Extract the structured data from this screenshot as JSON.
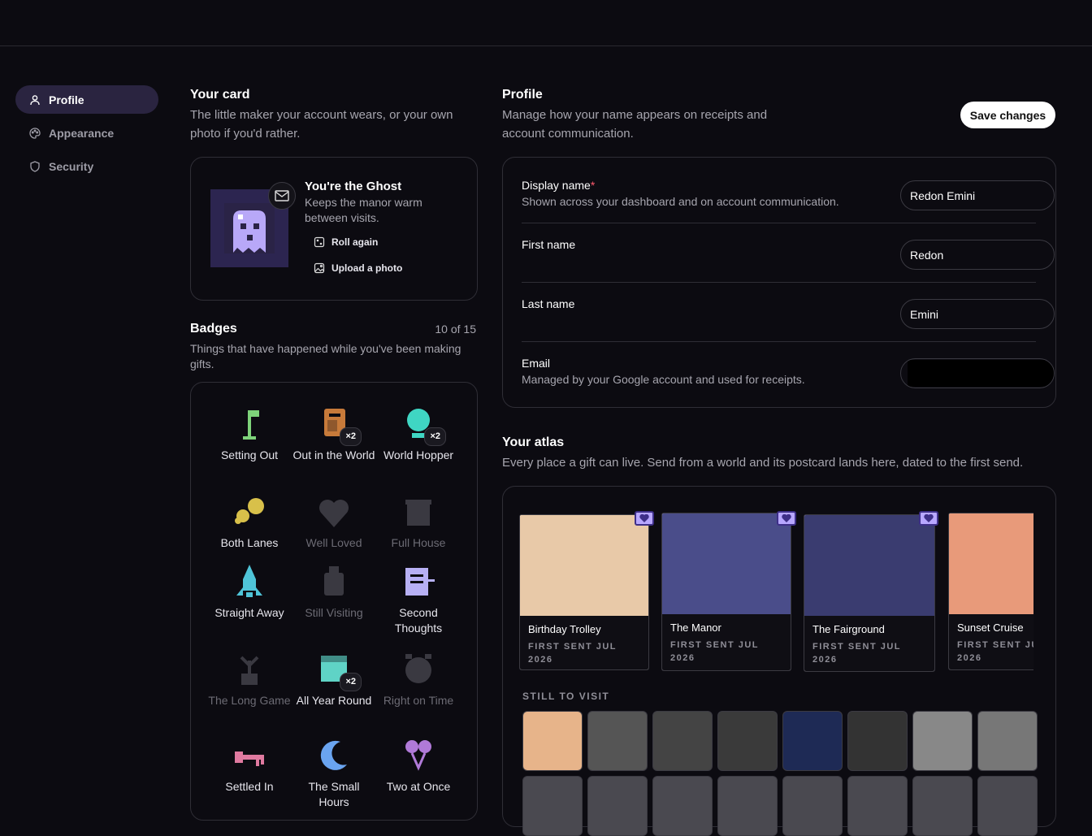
{
  "nav": {
    "items": [
      {
        "label": "Profile",
        "active": true
      },
      {
        "label": "Appearance"
      },
      {
        "label": "Security"
      }
    ]
  },
  "card": {
    "title": "Your card",
    "subtitle": "The little maker your account wears, or your own photo if you'd rather.",
    "role_name": "You're the Ghost",
    "role_desc": "Keeps the manor warm between visits.",
    "roll_label": "Roll again",
    "upload_label": "Upload a photo"
  },
  "badges": {
    "title": "Badges",
    "count": "10 of 15",
    "subtitle": "Things that have happened while you've been making gifts.",
    "items": [
      {
        "label": "Setting Out",
        "earned": true,
        "icon": "flag-icon",
        "color": "#7ed37a"
      },
      {
        "label": "Out in the World",
        "earned": true,
        "icon": "mailbox-icon",
        "mult": "×2",
        "color": "#c77a3a"
      },
      {
        "label": "World Hopper",
        "earned": true,
        "icon": "globe-icon",
        "mult": "×2",
        "color": "#3fd6c3"
      },
      {
        "label": "Both Lanes",
        "earned": true,
        "icon": "coins-icon",
        "color": "#d8c04a"
      },
      {
        "label": "Well Loved",
        "earned": false,
        "icon": "heart-icon"
      },
      {
        "label": "Full House",
        "earned": false,
        "icon": "house-icon"
      },
      {
        "label": "Straight Away",
        "earned": true,
        "icon": "rocket-icon",
        "color": "#4fc4d8"
      },
      {
        "label": "Still Visiting",
        "earned": false,
        "icon": "lantern-icon"
      },
      {
        "label": "Second Thoughts",
        "earned": true,
        "icon": "note-icon",
        "color": "#b7b0f4"
      },
      {
        "label": "The Long Game",
        "earned": false,
        "icon": "plant-icon"
      },
      {
        "label": "All Year Round",
        "earned": true,
        "icon": "calendar-icon",
        "mult": "×2",
        "color": "#5fd3c6"
      },
      {
        "label": "Right on Time",
        "earned": false,
        "icon": "clock-icon"
      },
      {
        "label": "Settled In",
        "earned": true,
        "icon": "key-icon",
        "color": "#e07aa0"
      },
      {
        "label": "The Small Hours",
        "earned": true,
        "icon": "moon-icon",
        "color": "#6aa4f0"
      },
      {
        "label": "Two at Once",
        "earned": true,
        "icon": "balloons-icon",
        "color": "#b07ad8"
      }
    ]
  },
  "profile": {
    "title": "Profile",
    "subtitle": "Manage how your name appears on receipts and account communication.",
    "save_label": "Save changes",
    "fields": [
      {
        "label": "Display name",
        "required": true,
        "desc": "Shown across your dashboard and on account communication.",
        "value": "Redon Emini"
      },
      {
        "label": "First name",
        "desc": "",
        "value": "Redon"
      },
      {
        "label": "Last name",
        "desc": "",
        "value": "Emini"
      },
      {
        "label": "Email",
        "desc": "Managed by your Google account and used for receipts.",
        "value": ""
      }
    ]
  },
  "atlas": {
    "title": "Your atlas",
    "subtitle": "Every place a gift can live. Send from a world and its postcard lands here, dated to the first send.",
    "postcards": [
      {
        "name": "Birthday Trolley",
        "date": "FIRST SENT JUL 2026",
        "color": "#e8c9a8"
      },
      {
        "name": "The Manor",
        "date": "FIRST SENT JUL 2026",
        "color": "#4a4d8a"
      },
      {
        "name": "The Fairground",
        "date": "FIRST SENT JUL 2026",
        "color": "#3a3c70"
      },
      {
        "name": "Sunset Cruise",
        "date": "FIRST SENT JU 2026",
        "color": "#e89a7a"
      }
    ],
    "still_label": "STILL TO VISIT",
    "thumbs_color": [
      "#e7b48a",
      "#555",
      "#444",
      "#3a3a3a",
      "#1e2a55",
      "#333",
      "#888",
      "#777"
    ]
  }
}
